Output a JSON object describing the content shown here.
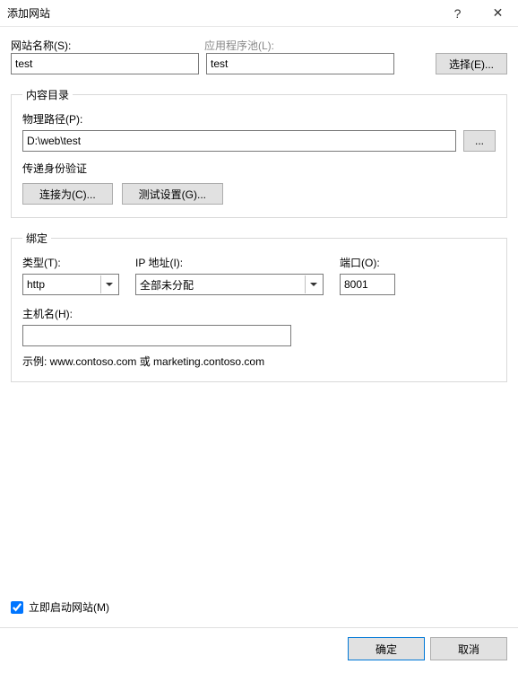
{
  "window": {
    "title": "添加网站",
    "help": "?",
    "close": "✕"
  },
  "site": {
    "name_label": "网站名称(S):",
    "name_value": "test",
    "apppool_label": "应用程序池(L):",
    "apppool_value": "test",
    "select_btn": "选择(E)..."
  },
  "content": {
    "legend": "内容目录",
    "path_label": "物理路径(P):",
    "path_value": "D:\\web\\test",
    "browse": "...",
    "auth_label": "传递身份验证",
    "connect_as": "连接为(C)...",
    "test_settings": "测试设置(G)..."
  },
  "binding": {
    "legend": "绑定",
    "type_label": "类型(T):",
    "type_value": "http",
    "ip_label": "IP 地址(I):",
    "ip_value": "全部未分配",
    "port_label": "端口(O):",
    "port_value": "8001",
    "host_label": "主机名(H):",
    "host_value": "",
    "example": "示例: www.contoso.com 或 marketing.contoso.com"
  },
  "footer": {
    "start_label": "立即启动网站(M)",
    "ok": "确定",
    "cancel": "取消"
  }
}
